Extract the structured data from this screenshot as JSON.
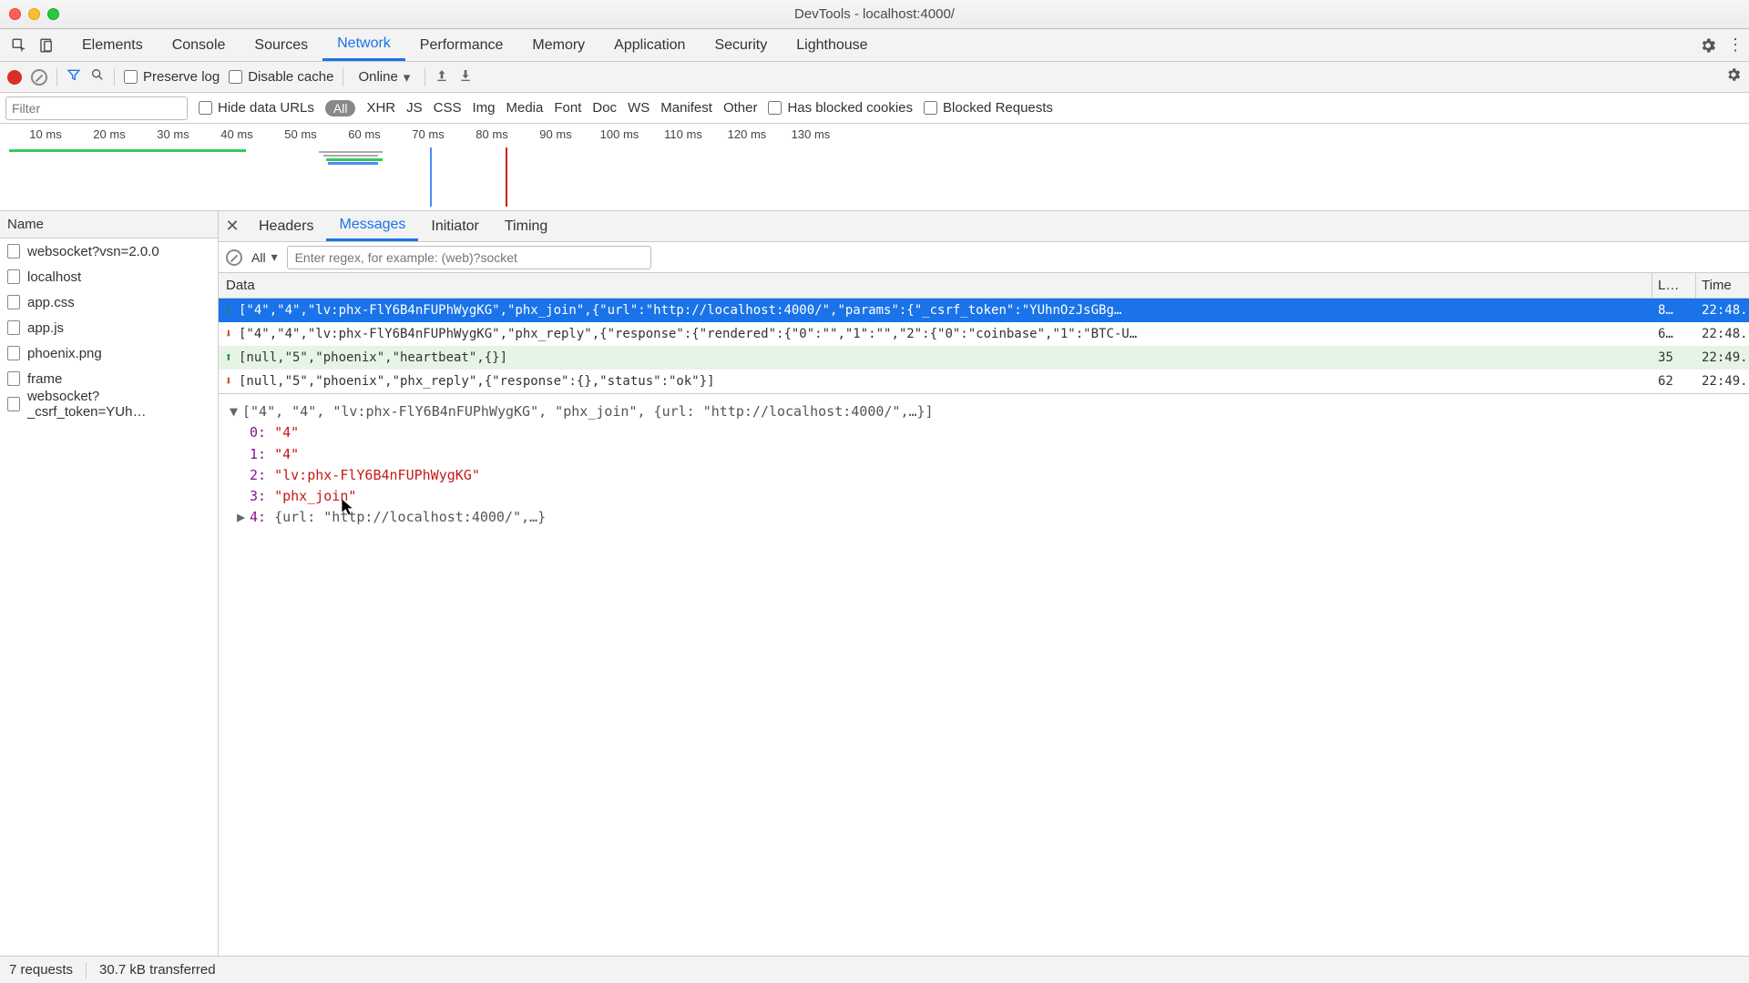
{
  "window": {
    "title": "DevTools - localhost:4000/"
  },
  "main_tabs": {
    "items": [
      "Elements",
      "Console",
      "Sources",
      "Network",
      "Performance",
      "Memory",
      "Application",
      "Security",
      "Lighthouse"
    ],
    "active_index": 3
  },
  "network_toolbar": {
    "preserve_log_label": "Preserve log",
    "disable_cache_label": "Disable cache",
    "throttle_value": "Online"
  },
  "filter_row": {
    "filter_placeholder": "Filter",
    "hide_data_urls_label": "Hide data URLs",
    "type_pill": "All",
    "types": [
      "XHR",
      "JS",
      "CSS",
      "Img",
      "Media",
      "Font",
      "Doc",
      "WS",
      "Manifest",
      "Other"
    ],
    "has_blocked_cookies_label": "Has blocked cookies",
    "blocked_requests_label": "Blocked Requests"
  },
  "timeline": {
    "ticks": [
      "10 ms",
      "20 ms",
      "30 ms",
      "40 ms",
      "50 ms",
      "60 ms",
      "70 ms",
      "80 ms",
      "90 ms",
      "100 ms",
      "110 ms",
      "120 ms",
      "130 ms"
    ]
  },
  "name_header": "Name",
  "requests": [
    {
      "name": "websocket?vsn=2.0.0"
    },
    {
      "name": "localhost"
    },
    {
      "name": "app.css"
    },
    {
      "name": "app.js"
    },
    {
      "name": "phoenix.png"
    },
    {
      "name": "frame"
    },
    {
      "name": "websocket?_csrf_token=YUh…"
    }
  ],
  "detail_tabs": {
    "items": [
      "Headers",
      "Messages",
      "Initiator",
      "Timing"
    ],
    "active_index": 1
  },
  "messages_toolbar": {
    "all_label": "All",
    "regex_placeholder": "Enter regex, for example: (web)?socket"
  },
  "msg_headers": {
    "data": "Data",
    "len": "L…",
    "time": "Time"
  },
  "messages": [
    {
      "dir": "up",
      "selected": true,
      "data": "[\"4\",\"4\",\"lv:phx-FlY6B4nFUPhWygKG\",\"phx_join\",{\"url\":\"http://localhost:4000/\",\"params\":{\"_csrf_token\":\"YUhnOzJsGBg…",
      "len": "8…",
      "time": "22:48."
    },
    {
      "dir": "down",
      "data": "[\"4\",\"4\",\"lv:phx-FlY6B4nFUPhWygKG\",\"phx_reply\",{\"response\":{\"rendered\":{\"0\":\"\",\"1\":\"\",\"2\":{\"0\":\"coinbase\",\"1\":\"BTC-U…",
      "len": "6…",
      "time": "22:48."
    },
    {
      "dir": "up",
      "heartbeat": true,
      "data": "[null,\"5\",\"phoenix\",\"heartbeat\",{}]",
      "len": "35",
      "time": "22:49."
    },
    {
      "dir": "down",
      "data": "[null,\"5\",\"phoenix\",\"phx_reply\",{\"response\":{},\"status\":\"ok\"}]",
      "len": "62",
      "time": "22:49."
    }
  ],
  "tree": {
    "root": "[\"4\", \"4\", \"lv:phx-FlY6B4nFUPhWygKG\", \"phx_join\", {url: \"http://localhost:4000/\",…}]",
    "items": [
      {
        "idx": "0:",
        "val": "\"4\""
      },
      {
        "idx": "1:",
        "val": "\"4\""
      },
      {
        "idx": "2:",
        "val": "\"lv:phx-FlY6B4nFUPhWygKG\""
      },
      {
        "idx": "3:",
        "val": "\"phx_join\""
      }
    ],
    "last_idx": "4:",
    "last_val": "{url: \"http://localhost:4000/\",…}"
  },
  "statusbar": {
    "requests": "7 requests",
    "transferred": "30.7 kB transferred"
  }
}
